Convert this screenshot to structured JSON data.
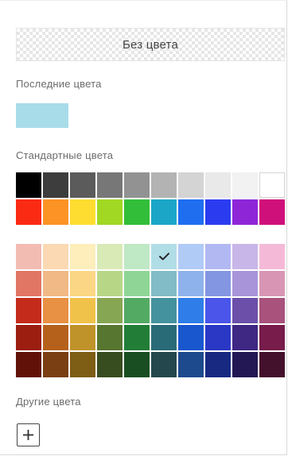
{
  "no_color": {
    "label": "Без цвета"
  },
  "recent": {
    "label": "Последние цвета",
    "colors": [
      "#a8dce8"
    ]
  },
  "standard": {
    "label": "Стандартные цвета",
    "rows": [
      [
        "#000000",
        "#3d3d3d",
        "#5b5b5b",
        "#777777",
        "#929292",
        "#b3b3b3",
        "#d4d4d4",
        "#e9e9e9",
        "#f2f2f2",
        "#ffffff"
      ],
      [
        "#fb2a12",
        "#fc9324",
        "#fedd30",
        "#a0d824",
        "#32be38",
        "#1ba6c8",
        "#1f6ef0",
        "#2b3cf0",
        "#8e26d8",
        "#d0107a"
      ]
    ]
  },
  "palette": {
    "selected": {
      "row": 0,
      "col": 5
    },
    "selected_icon": "check-icon",
    "rows": [
      [
        "#f2bcb3",
        "#fbd9b2",
        "#fdeebb",
        "#d9eab6",
        "#bfe8c5",
        "#b1dde6",
        "#b1cbf7",
        "#b2b8f2",
        "#c9b6e8",
        "#f5b9d8"
      ],
      [
        "#e27664",
        "#f1b985",
        "#fbd785",
        "#b7d787",
        "#8fd696",
        "#82bcc6",
        "#8eb2ec",
        "#8396e2",
        "#a895d9",
        "#d896b4"
      ],
      [
        "#c52b1a",
        "#e89043",
        "#f1c24a",
        "#87a653",
        "#53aa63",
        "#44929e",
        "#2f7de8",
        "#4b55ea",
        "#6b4fa9",
        "#a8527c"
      ],
      [
        "#9b1e10",
        "#b5611c",
        "#c0932a",
        "#577630",
        "#227e37",
        "#2a6b78",
        "#1957cf",
        "#2a38c5",
        "#3f2784",
        "#781c4b"
      ],
      [
        "#621108",
        "#7a3f12",
        "#7e5d14",
        "#374c1f",
        "#184e21",
        "#24474d",
        "#1d4a8c",
        "#172981",
        "#231854",
        "#44112c"
      ]
    ]
  },
  "custom": {
    "label": "Другие цвета",
    "add_icon": "plus-icon"
  }
}
